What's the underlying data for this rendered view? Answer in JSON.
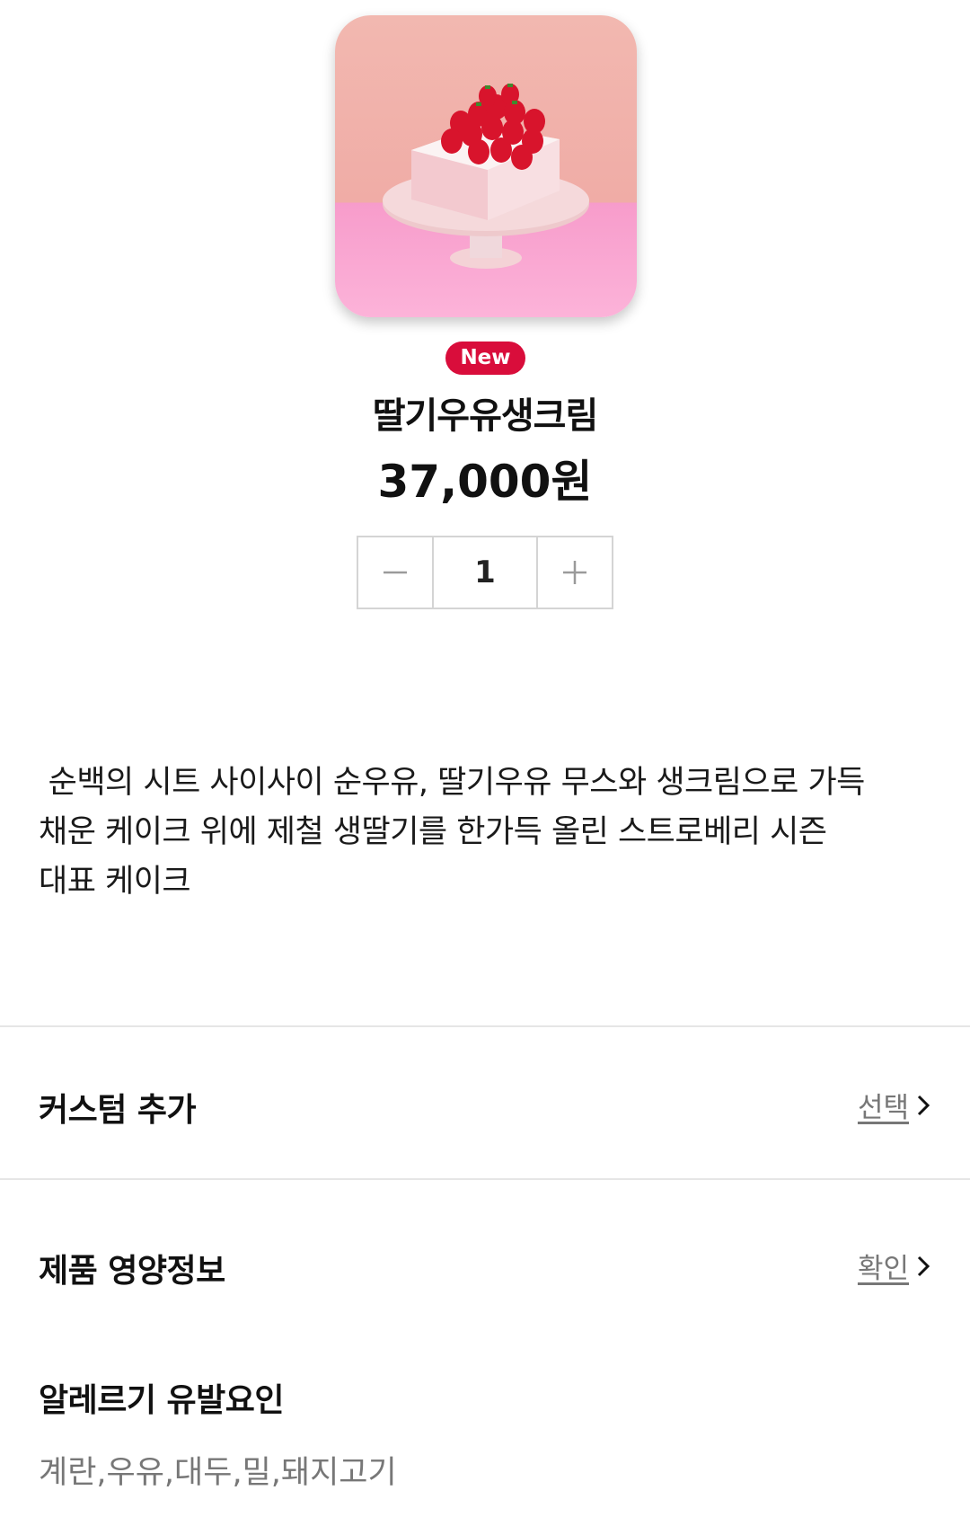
{
  "product": {
    "badge": "New",
    "name": "딸기우유생크림",
    "price": "37,000원",
    "image_icon": "strawberry-cake-image"
  },
  "quantity": {
    "value": "1",
    "decrement_icon": "minus-icon",
    "increment_icon": "plus-icon"
  },
  "description": " 순백의 시트 사이사이 순우유, 딸기우유 무스와 생크림으로 가득\n채운 케이크 위에 제철 생딸기를 한가득 올린 스트로베리 시즌\n대표 케이크",
  "custom": {
    "title": "커스텀 추가",
    "action": "선택"
  },
  "nutrition": {
    "title": "제품 영양정보",
    "action": "확인"
  },
  "allergy": {
    "title": "알레르기 유발요인",
    "items": "계란,우유,대두,밀,돼지고기"
  },
  "colors": {
    "badge": "#d90d3b",
    "muted_text": "#777777",
    "divider": "#e6e6e6"
  }
}
